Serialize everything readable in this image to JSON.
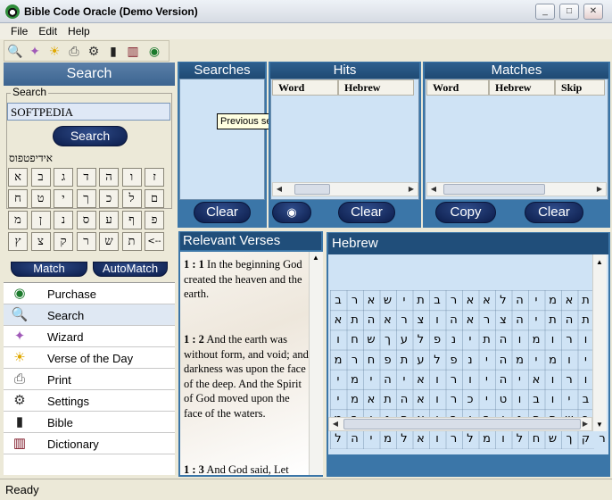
{
  "window": {
    "title": "Bible Code Oracle (Demo Version)",
    "controls": {
      "minimize": "_",
      "maximize": "□",
      "close": "✕"
    }
  },
  "menu": {
    "items": [
      "File",
      "Edit",
      "Help"
    ]
  },
  "toolbar": {
    "icons": [
      "search-icon",
      "wizard-icon",
      "sun-icon",
      "printer-icon",
      "settings-icon",
      "bible-icon",
      "dictionary-icon",
      "eye-icon"
    ]
  },
  "search_panel": {
    "header": "Search",
    "group_label": "Search",
    "input_value": "SOFTPEDIA",
    "search_button": "Search",
    "hebrew_text": "אידיפטפוס",
    "keys": [
      [
        "א",
        "ב",
        "ג",
        "ד",
        "ה",
        "ו",
        "ז"
      ],
      [
        "ח",
        "ט",
        "י",
        "ך",
        "כ",
        "ל",
        "ם"
      ],
      [
        "מ",
        "ן",
        "נ",
        "ס",
        "ע",
        "ף",
        "פ"
      ],
      [
        "ץ",
        "צ",
        "ק",
        "ר",
        "ש",
        "ת",
        "<--"
      ]
    ],
    "match_button": "Match",
    "automatch_button": "AutoMatch"
  },
  "nav": {
    "items": [
      {
        "label": "Purchase",
        "icon": "eye-icon"
      },
      {
        "label": "Search",
        "icon": "magnifier-icon"
      },
      {
        "label": "Wizard",
        "icon": "wizard-icon"
      },
      {
        "label": "Verse of the Day",
        "icon": "sun-icon"
      },
      {
        "label": "Print",
        "icon": "printer-icon"
      },
      {
        "label": "Settings",
        "icon": "gears-icon"
      },
      {
        "label": "Bible",
        "icon": "book-icon"
      },
      {
        "label": "Dictionary",
        "icon": "books-icon"
      }
    ]
  },
  "searches": {
    "header": "Searches",
    "clear_button": "Clear",
    "tooltip": "Previous searches list"
  },
  "hits": {
    "header": "Hits",
    "columns": [
      "Word",
      "Hebrew"
    ],
    "clear_button": "Clear"
  },
  "matches": {
    "header": "Matches",
    "columns": [
      "Word",
      "Hebrew",
      "Skip"
    ],
    "copy_button": "Copy",
    "clear_button": "Clear"
  },
  "verses": {
    "header": "Relevant Verses",
    "items": [
      {
        "ref": "1 : 1",
        "text": "In the beginning God created the heaven and the earth."
      },
      {
        "ref": "1 : 2",
        "text": "And the earth was without form, and void; and darkness was upon the face of the deep. And the Spirit of God moved upon the face of the waters."
      },
      {
        "ref": "1 : 3",
        "text": "And God said, Let"
      }
    ]
  },
  "hebrew": {
    "header": "Hebrew",
    "rows": [
      "בראשיתבראאלהימאתהשמימו",
      "אתהארצוהארצהיתהתהוובהו",
      "וחשךעלפניתהומורוחאלהימ",
      "מרחפתעלפניהמימויאמראלה",
      "ימיהיאורויהיאורויראאלה",
      "ימאתהאורכיטובויבדלאלהי",
      "מבינהאורובינהחשךויקראא",
      "להימלאורלמולחשךקראליל"
    ]
  },
  "status": {
    "text": "Ready"
  },
  "colors": {
    "panel_blue": "#3b76a8",
    "list_bg": "#cfe3f5",
    "header_navy": "#204e7a"
  }
}
